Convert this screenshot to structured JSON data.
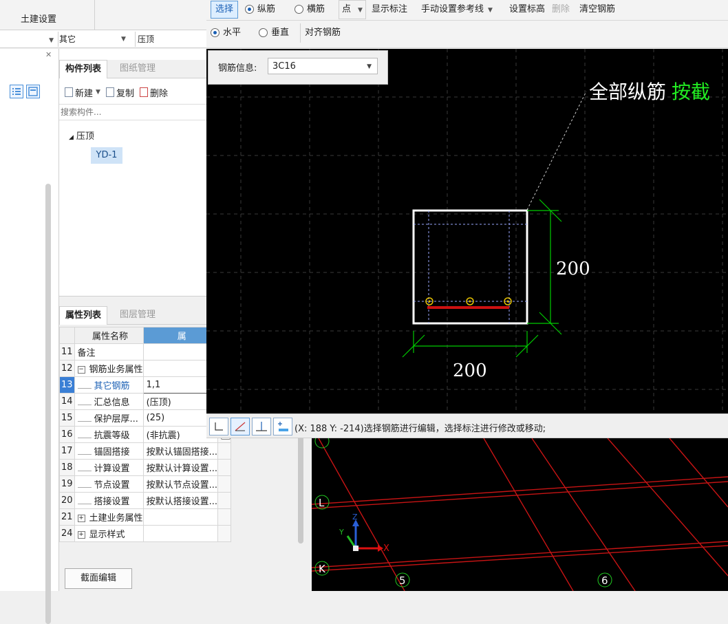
{
  "ribbon": {
    "tab_label": "土建设置"
  },
  "filter": {
    "left_value": "",
    "mid_value": "其它",
    "right_value": "压顶"
  },
  "component_panel": {
    "tabs": [
      "构件列表",
      "图纸管理"
    ],
    "toolbar": {
      "new_label": "新建",
      "copy_label": "复制",
      "delete_label": "删除"
    },
    "search_placeholder": "搜索构件...",
    "tree": {
      "root": "压顶",
      "leaf": "YD-1"
    }
  },
  "property_panel": {
    "tabs": [
      "属性列表",
      "图层管理"
    ],
    "header": {
      "name_col": "属性名称",
      "value_col": "属"
    },
    "rows": [
      {
        "num": "11",
        "name": "备注",
        "value": ""
      },
      {
        "num": "12",
        "name": "钢筋业务属性",
        "value": "",
        "expander": "−"
      },
      {
        "num": "13",
        "name": "其它钢筋",
        "value": "1,1"
      },
      {
        "num": "14",
        "name": "汇总信息",
        "value": "(压顶)"
      },
      {
        "num": "15",
        "name": "保护层厚...",
        "value": "(25)"
      },
      {
        "num": "16",
        "name": "抗震等级",
        "value": "(非抗震)"
      },
      {
        "num": "17",
        "name": "锚固搭接",
        "value": "按默认锚固搭接..."
      },
      {
        "num": "18",
        "name": "计算设置",
        "value": "按默认计算设置..."
      },
      {
        "num": "19",
        "name": "节点设置",
        "value": "按默认节点设置..."
      },
      {
        "num": "20",
        "name": "搭接设置",
        "value": "按默认搭接设置..."
      },
      {
        "num": "21",
        "name": "土建业务属性",
        "value": "",
        "expander": "+"
      },
      {
        "num": "24",
        "name": "显示样式",
        "value": "",
        "expander": "+"
      }
    ],
    "section_edit_button": "截面编辑"
  },
  "toolbar1": {
    "select": "选择",
    "longitudinal": "纵筋",
    "transverse": "横筋",
    "point": "点",
    "show_annotation": "显示标注",
    "manual_ref_line": "手动设置参考线",
    "set_elevation": "设置标高",
    "delete": "删除",
    "clear_rebar": "清空钢筋"
  },
  "toolbar2": {
    "horizontal": "水平",
    "vertical": "垂直",
    "align_rebar": "对齐钢筋"
  },
  "rebar_info": {
    "caption": "钢筋信息:",
    "value": "3C16"
  },
  "canvas": {
    "annotation_white": "全部纵筋",
    "annotation_green": "按截",
    "dim_vertical": "200",
    "dim_horizontal": "200",
    "colors": {
      "background": "#000000",
      "section": "#ffffff",
      "dimension": "#00cc00",
      "rebar": "#cc1111",
      "point": "#e6c200"
    }
  },
  "status": {
    "message": "(X: 188 Y: -214)选择钢筋进行编辑，选择标注进行修改或移动;"
  },
  "view3d": {
    "axis_labels": {
      "l": "L",
      "k": "K",
      "five": "5",
      "six": "6",
      "x": "X",
      "y": "Y",
      "z": "Z"
    }
  }
}
